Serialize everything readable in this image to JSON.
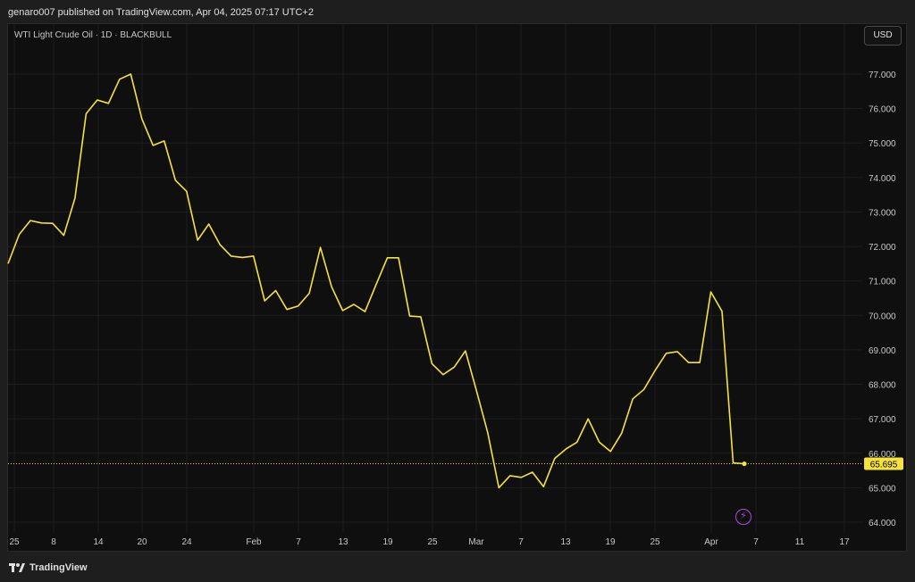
{
  "header": {
    "published_text": "genaro007 published on TradingView.com, Apr 04, 2025 07:17 UTC+2"
  },
  "chart": {
    "title": "WTI Light Crude Oil · 1D · BLACKBULL",
    "currency_label": "USD"
  },
  "footer": {
    "brand": "TradingView"
  },
  "colors": {
    "line": "#f5e23a",
    "background": "#0f0f0f",
    "grid": "#1e1e1e",
    "text": "#c8c8c8",
    "price_tag_bg": "#f5e23a",
    "icon_accent": "#b04cdc"
  },
  "icons": [
    "tradingview-logo-icon",
    "lightning-icon"
  ],
  "chart_data": {
    "type": "line",
    "title": "WTI Light Crude Oil · 1D · BLACKBULL",
    "ylim": [
      64,
      77.5
    ],
    "y_ticks": [
      "64.000",
      "65.000",
      "66.000",
      "67.000",
      "68.000",
      "69.000",
      "70.000",
      "71.000",
      "72.000",
      "73.000",
      "74.000",
      "75.000",
      "76.000",
      "77.000"
    ],
    "x_ticks": [
      "25",
      "8",
      "14",
      "20",
      "24",
      "Feb",
      "7",
      "13",
      "19",
      "25",
      "Mar",
      "7",
      "13",
      "19",
      "25",
      "Apr",
      "7",
      "11",
      "17"
    ],
    "last_price": "65.695",
    "grid": true,
    "series": [
      {
        "values": [
          71.5,
          72.35,
          72.75,
          72.68,
          72.67,
          72.32,
          73.4,
          75.85,
          76.25,
          76.15,
          76.85,
          77.0,
          75.7,
          74.93,
          75.06,
          73.92,
          73.6,
          72.18,
          72.65,
          72.05,
          71.72,
          71.68,
          71.72,
          70.42,
          70.72,
          70.17,
          70.27,
          70.64,
          71.97,
          70.83,
          70.14,
          70.32,
          70.11,
          70.9,
          71.67,
          71.67,
          69.98,
          69.96,
          68.6,
          68.28,
          68.5,
          68.97,
          67.8,
          66.6,
          65.0,
          65.35,
          65.3,
          65.45,
          65.03,
          65.85,
          66.12,
          66.32,
          67.0,
          66.32,
          66.05,
          66.58,
          67.58,
          67.85,
          68.4,
          68.9,
          68.95,
          68.63,
          68.63,
          70.68,
          70.12,
          65.72,
          65.695
        ]
      }
    ]
  }
}
